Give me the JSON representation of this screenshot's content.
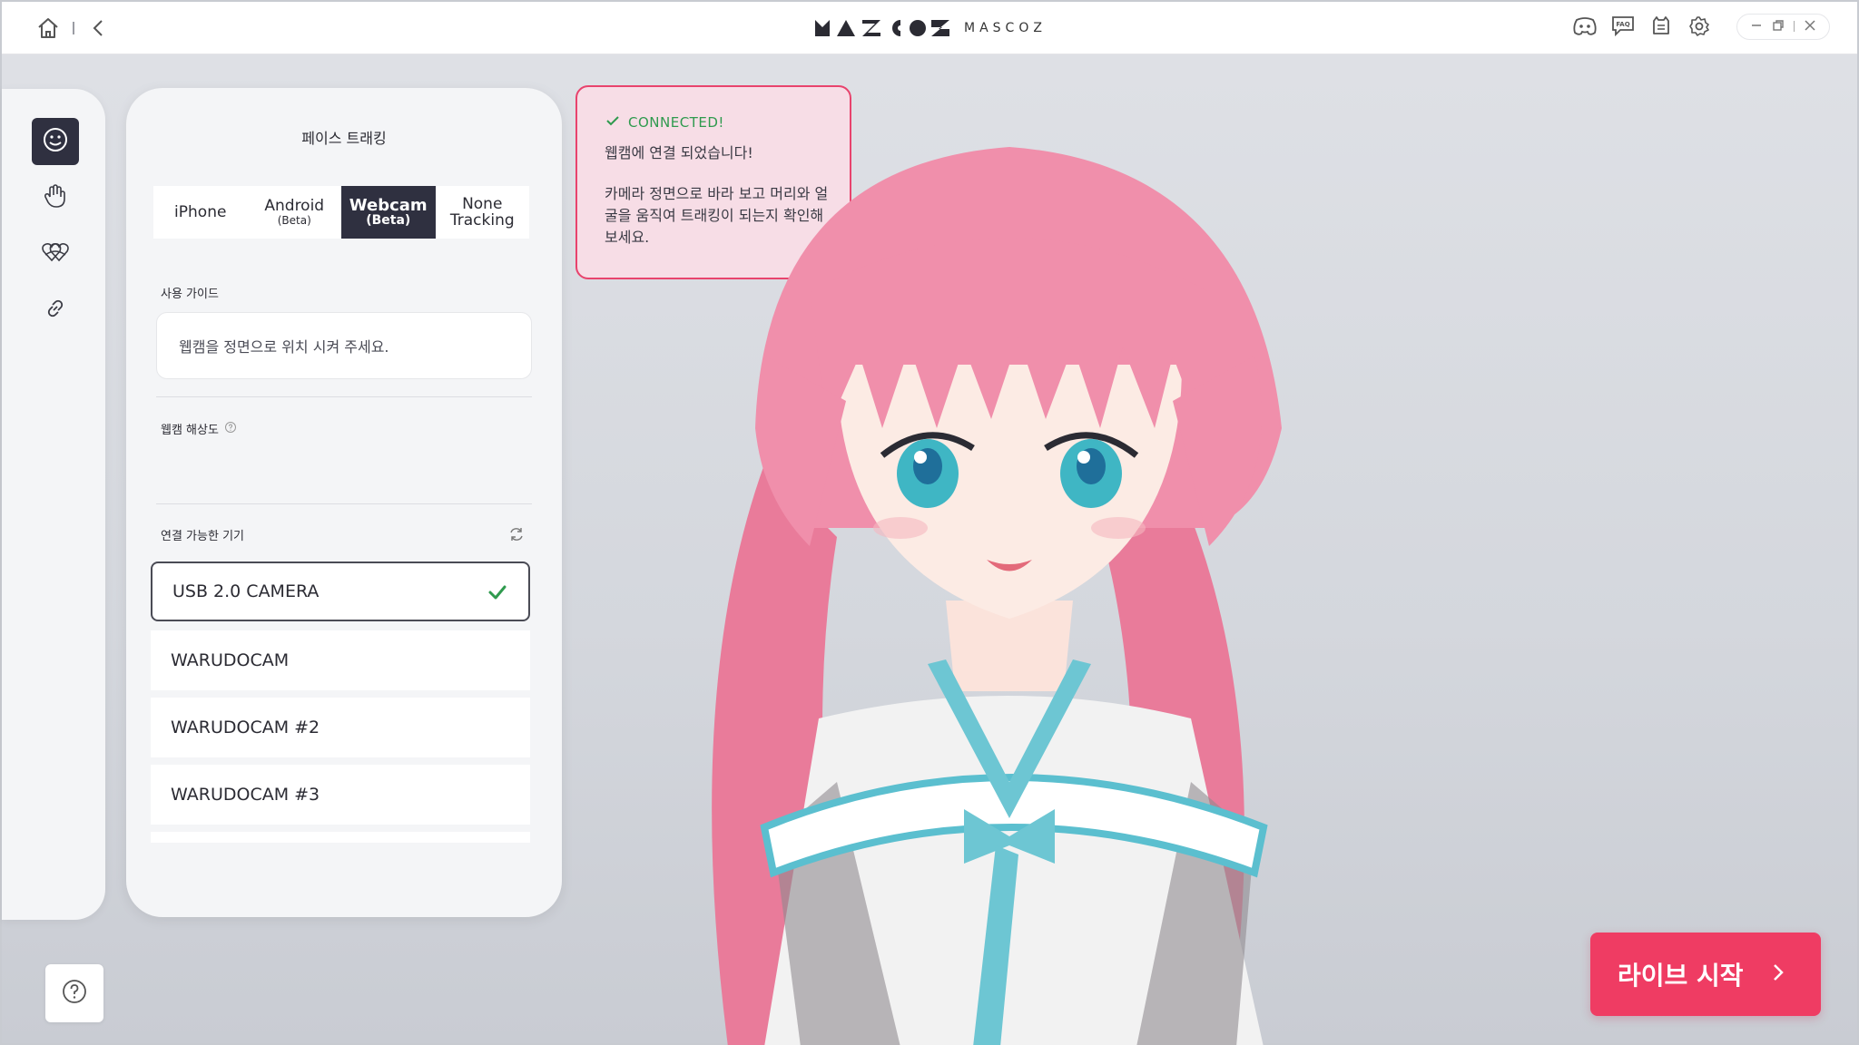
{
  "app": {
    "brand": "MASCOZ",
    "colors": {
      "accent": "#ef3c63",
      "dark": "#2f3040",
      "success": "#2f9a4e"
    }
  },
  "titlebar": {
    "left_icons": [
      "home-icon",
      "back-icon"
    ],
    "right_icons": [
      "discord-icon",
      "faq-icon",
      "mascot-icon",
      "settings-icon"
    ],
    "window_controls": [
      "minimize-icon",
      "restore-icon",
      "close-icon"
    ]
  },
  "rail": {
    "items": [
      {
        "name": "face-tracking",
        "icon": "smile-icon",
        "active": true
      },
      {
        "name": "hand-tracking",
        "icon": "hand-icon",
        "active": false
      },
      {
        "name": "expression",
        "icon": "hearts-icon",
        "active": false
      },
      {
        "name": "connection",
        "icon": "link-icon",
        "active": false
      }
    ],
    "help_icon": "question-icon"
  },
  "panel": {
    "title": "페이스 트래킹",
    "tabs": [
      {
        "label": "iPhone",
        "sub": "",
        "active": false
      },
      {
        "label": "Android",
        "sub": "(Beta)",
        "active": false
      },
      {
        "label": "Webcam",
        "sub": "(Beta)",
        "active": true
      },
      {
        "label": "None",
        "sub": "Tracking",
        "active": false
      }
    ],
    "guide_label": "사용 가이드",
    "guide_text": "웹캠을 정면으로 위치 시켜 주세요.",
    "resolution_label": "웹캠 해상도",
    "devices_label": "연결 가능한 기기",
    "devices": [
      {
        "name": "USB 2.0 CAMERA",
        "selected": true
      },
      {
        "name": "WARUDOCAM",
        "selected": false
      },
      {
        "name": "WARUDOCAM #2",
        "selected": false
      },
      {
        "name": "WARUDOCAM #3",
        "selected": false
      }
    ]
  },
  "toast": {
    "status": "CONNECTED!",
    "line1": "웹캠에 연결 되었습니다!",
    "line2": "카메라 정면으로 바라 보고 머리와 얼굴을 움직여 트래킹이 되는지 확인해 보세요."
  },
  "live_button": {
    "label": "라이브 시작"
  }
}
